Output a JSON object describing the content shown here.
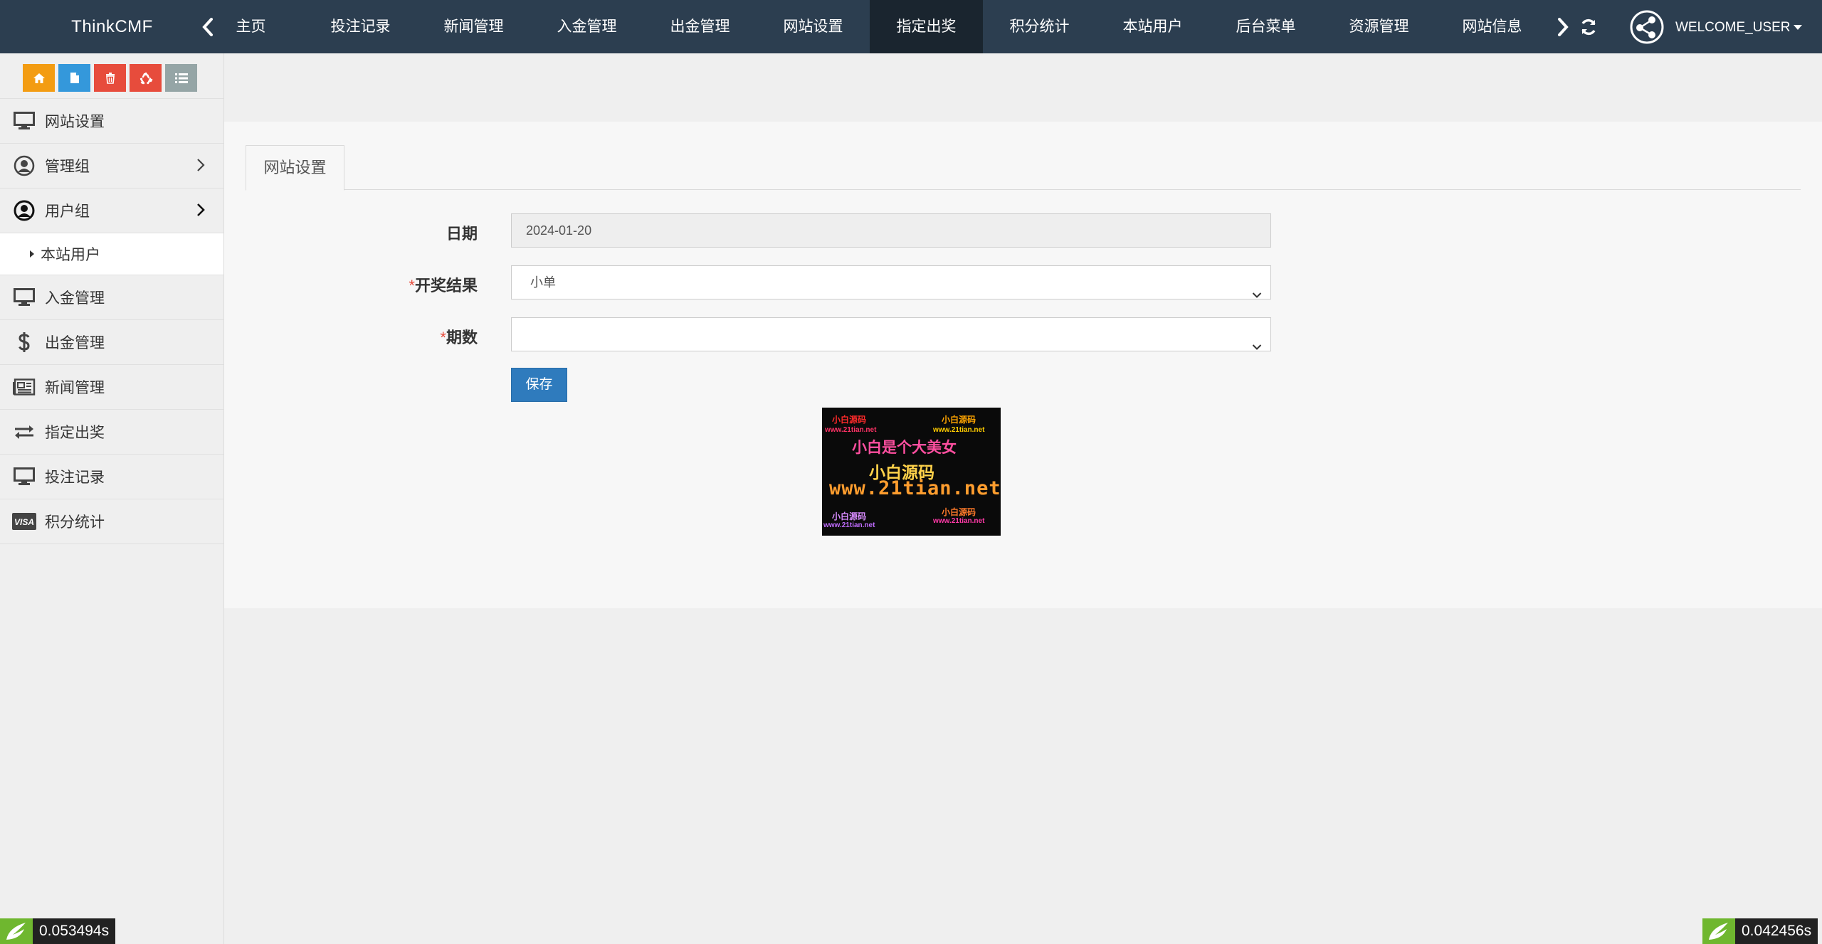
{
  "brand": "ThinkCMF",
  "nav": {
    "tabs": [
      "主页",
      "投注记录",
      "新闻管理",
      "入金管理",
      "出金管理",
      "网站设置",
      "指定出奖",
      "积分统计",
      "本站用户",
      "后台菜单",
      "资源管理",
      "网站信息"
    ],
    "active_tab": "指定出奖",
    "user": "WELCOME_USER"
  },
  "sidebar": {
    "items": [
      {
        "label": "网站设置",
        "icon": "monitor-icon"
      },
      {
        "label": "管理组",
        "icon": "user-circle-icon",
        "expandable": true
      },
      {
        "label": "用户组",
        "icon": "user-circle-icon",
        "expandable": true,
        "expanded": true
      },
      {
        "label": "本站用户",
        "sub": true
      },
      {
        "label": "入金管理",
        "icon": "monitor-icon"
      },
      {
        "label": "出金管理",
        "icon": "dollar-icon"
      },
      {
        "label": "新闻管理",
        "icon": "newspaper-icon"
      },
      {
        "label": "指定出奖",
        "icon": "exchange-icon"
      },
      {
        "label": "投注记录",
        "icon": "monitor-icon"
      },
      {
        "label": "积分统计",
        "icon": "visa-card-icon"
      }
    ],
    "quick_buttons": [
      {
        "icon": "home-icon",
        "color": "#f39c12"
      },
      {
        "icon": "file-icon",
        "color": "#3498db"
      },
      {
        "icon": "trash-icon",
        "color": "#e74c3c"
      },
      {
        "icon": "recycle-icon",
        "color": "#e74c3c"
      },
      {
        "icon": "list-icon",
        "color": "#95a5a6"
      }
    ]
  },
  "panel": {
    "tab": "网站设置",
    "fields": {
      "date_label": "日期",
      "date_value": "2024-01-20",
      "result_label": "开奖结果",
      "result_value": "小单",
      "period_label": "期数",
      "period_value": "",
      "required_mark": "*"
    },
    "save_label": "保存",
    "banner": {
      "tl": "小白源码",
      "tl2": "www.21tian.net",
      "tr": "小白源码",
      "tr2": "www.21tian.net",
      "main": "小白是个大美女",
      "mid": "小白源码",
      "url": "www.21tian.net",
      "bl": "小白源码",
      "bl2": "www.21tian.net",
      "br": "小白源码",
      "br2": "www.21tian.net"
    }
  },
  "timers": {
    "left": "0.053494s",
    "right": "0.042456s"
  },
  "colors": {
    "navbar": "#2c3e50",
    "nav_active": "#1a252f",
    "primary_button": "#2f7bbd",
    "required": "#e74c3c"
  }
}
